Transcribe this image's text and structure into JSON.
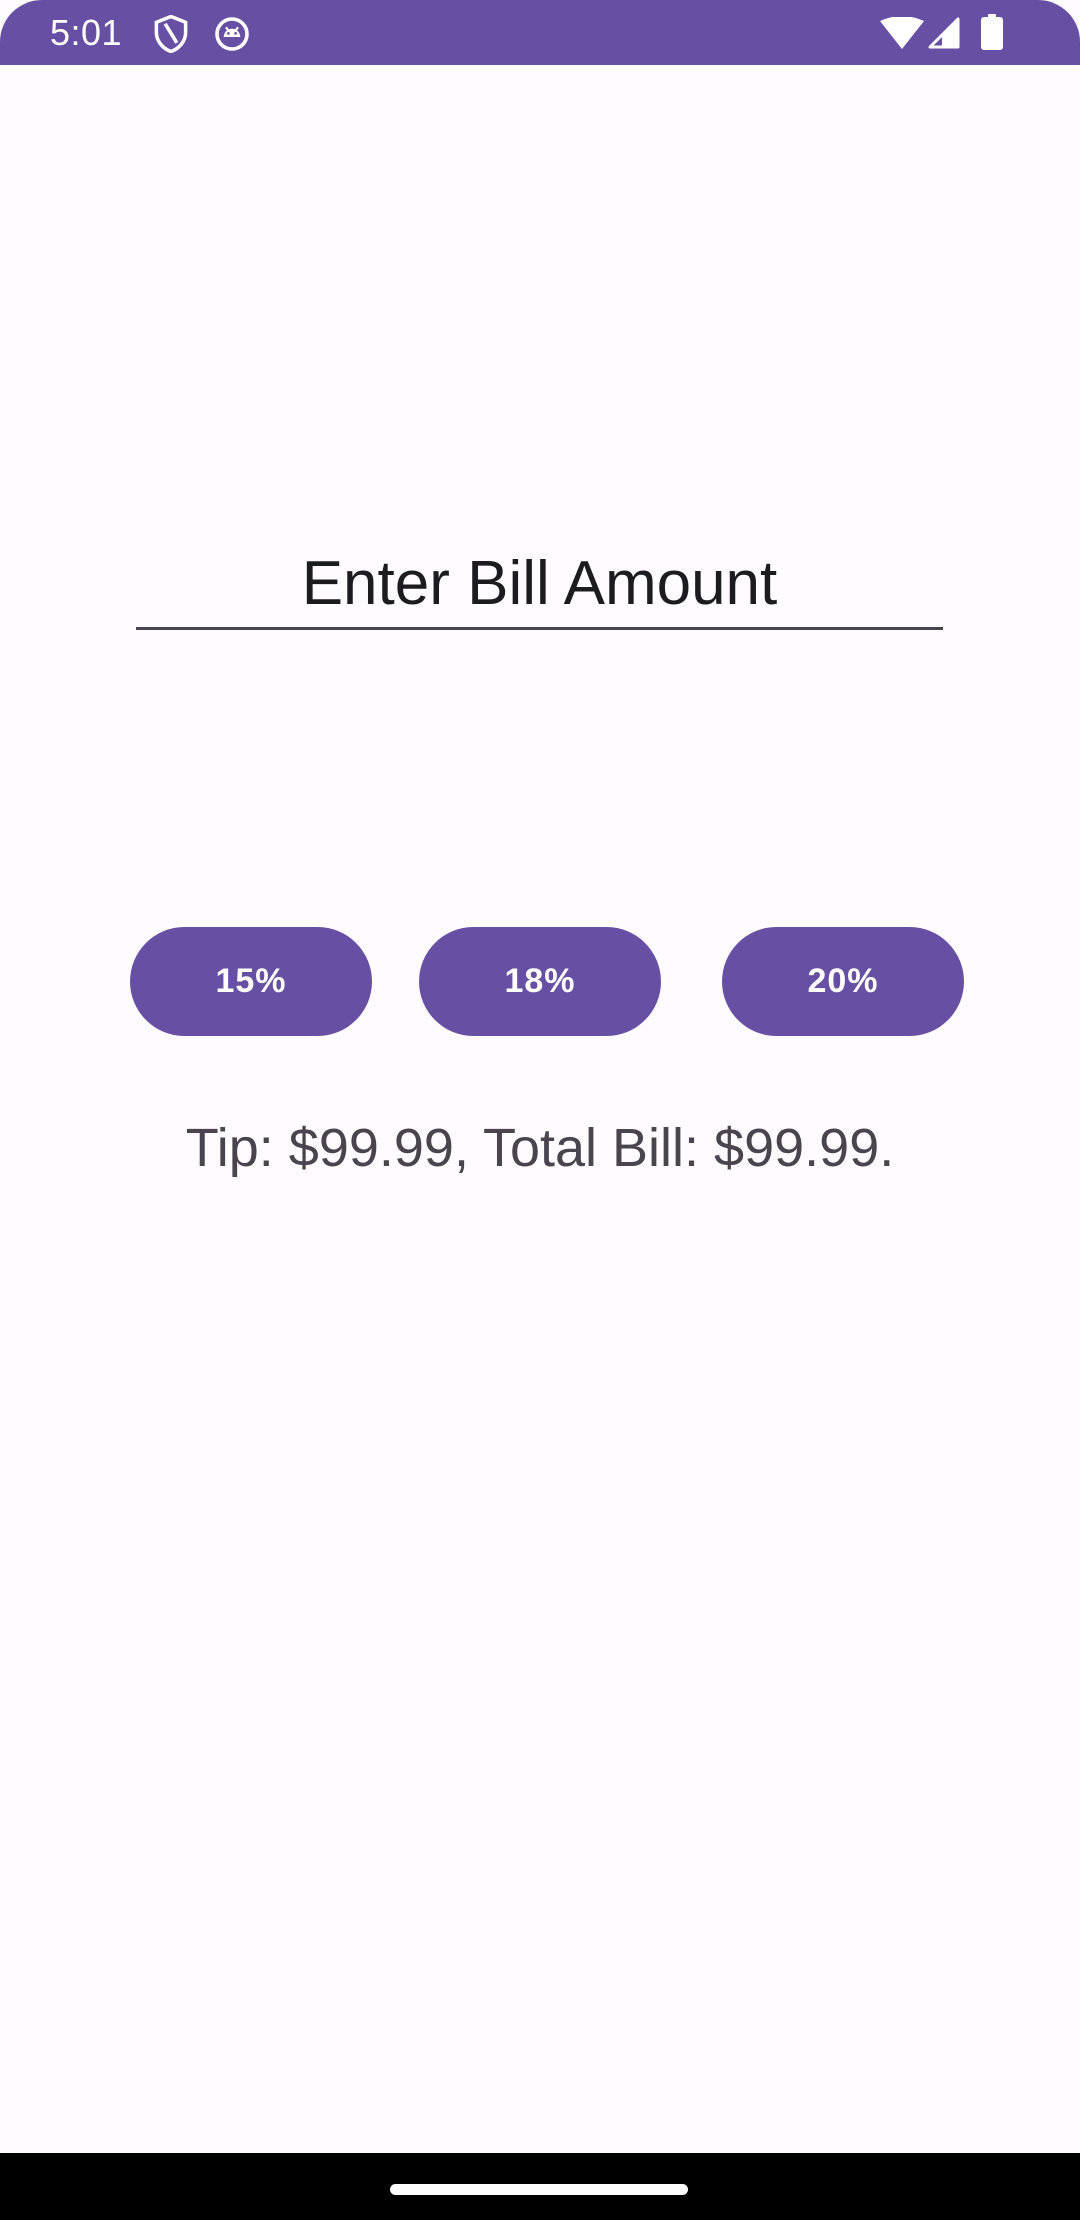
{
  "status_bar": {
    "time": "5:01",
    "background_color": "#6750A4",
    "left_icons": [
      "shield-icon",
      "android-debug-icon"
    ],
    "right_icons": [
      "wifi-icon",
      "cell-signal-icon",
      "battery-icon"
    ]
  },
  "bill_input": {
    "placeholder": "Enter Bill Amount",
    "value": ""
  },
  "tip_buttons": [
    {
      "label": "15%"
    },
    {
      "label": "18%"
    },
    {
      "label": "20%"
    }
  ],
  "result": {
    "text": "Tip: $99.99, Total Bill: $99.99."
  },
  "colors": {
    "accent": "#6750A4",
    "background": "#FFFBFE",
    "text_primary": "#1C1B1F",
    "text_secondary": "#49454F"
  }
}
